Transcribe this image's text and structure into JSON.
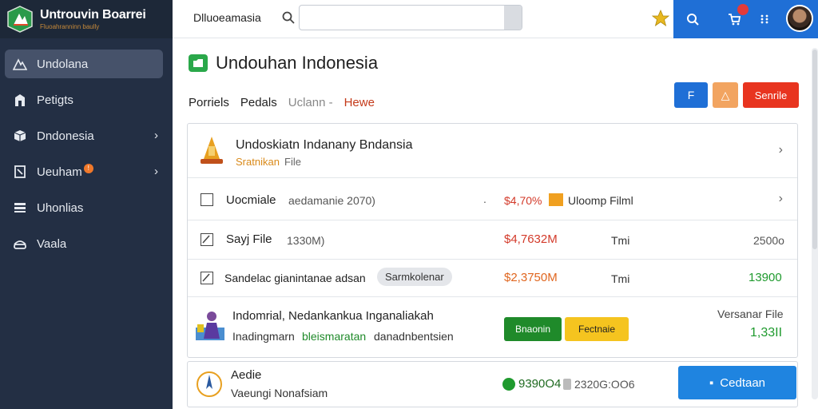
{
  "brand": {
    "title": "Untrouvin Boarrei",
    "subtitle": "Fluoahranninn baully"
  },
  "sidebar": {
    "items": [
      {
        "label": "Undolana"
      },
      {
        "label": "Petigts"
      },
      {
        "label": "Dndonesia"
      },
      {
        "label": "Ueuham"
      },
      {
        "label": "Uhonlias"
      },
      {
        "label": "Vaala"
      }
    ]
  },
  "topbar": {
    "breadcrumb": "Dlluoeamasia",
    "search_value": ""
  },
  "main": {
    "title": "Undouhan Indonesia",
    "tabs": [
      "Porriels",
      "Pedals",
      "Uclann -",
      "Hewe"
    ],
    "actions": {
      "blue": "F",
      "orange": "△",
      "red": "Senrile"
    },
    "header_row": {
      "title": "Undoskiatn Indanany Bndansia",
      "sub_highlight": "Sratnikan",
      "sub_rest": "File"
    },
    "rows": [
      {
        "name": "Uocmiale",
        "desc": "aedamanie 2070)",
        "mark": ".",
        "amount": "$4,70%",
        "tag": "Uloomp Filml"
      },
      {
        "name": "Sayj File",
        "desc": "1330M)",
        "amount": "$4,7632M",
        "col3": "Tmi",
        "col4": "2500o"
      },
      {
        "name": "Sandelac gianintanae adsan",
        "pill": "Sarmkolenar",
        "amount": "$2,3750M",
        "col3": "Tmi",
        "col4": "13900"
      },
      {
        "title": "Indomrial, Nedankankua Inganaliakah",
        "sub_a": "Inadingmarn",
        "sub_b": "bleismaratan",
        "sub_c": "danadnbentsien",
        "btn_green": "Bnaonin",
        "btn_yellow": "Fectnaie",
        "right_label": "Versanar File",
        "right_value": "1,33II"
      }
    ],
    "bottom": {
      "title": "Aedie",
      "sub": "Vaeungi  Nonafsiam",
      "stat_a": "9390O4",
      "stat_b": "2320G:OO6",
      "button": "Cedtaan"
    }
  },
  "colors": {
    "sidebar": "#232f44",
    "accent_blue": "#1f6fd6",
    "accent_red": "#e8341f",
    "amount_red": "#d33a2a",
    "amount_orange": "#e0661f",
    "positive_green": "#1f9a2e"
  }
}
